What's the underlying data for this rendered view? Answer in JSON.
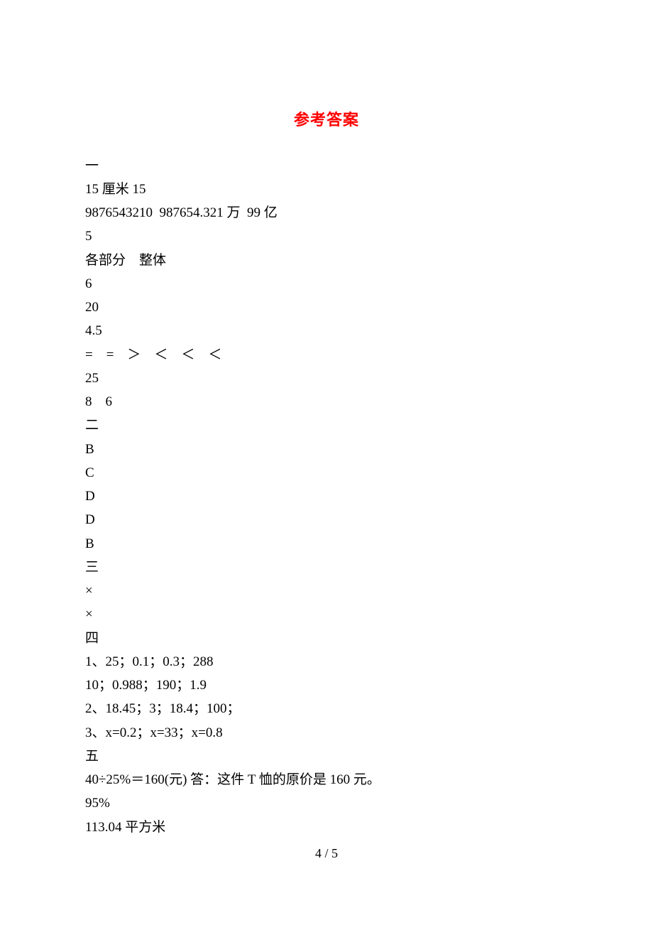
{
  "title": "参考答案",
  "sections": {
    "one": {
      "heading": "一",
      "lines": [
        "15 厘米 15",
        "9876543210  987654.321 万  99 亿",
        "5",
        "各部分    整体",
        "6",
        "20",
        "4.5",
        "=    =    ＞    ＜    ＜    ＜",
        "25",
        "8    6"
      ]
    },
    "two": {
      "heading": "二",
      "lines": [
        "B",
        "C",
        "D",
        "D",
        "B"
      ]
    },
    "three": {
      "heading": "三",
      "lines": [
        "×",
        "×"
      ]
    },
    "four": {
      "heading": "四",
      "lines": [
        "1、25；0.1；0.3；288",
        "10；0.988；190；1.9",
        "2、18.45；3；18.4；100；",
        "3、x=0.2；x=33；x=0.8"
      ]
    },
    "five": {
      "heading": "五",
      "lines": [
        "40÷25%＝160(元) 答：这件 T 恤的原价是 160 元。",
        "95%",
        "113.04 平方米"
      ]
    }
  },
  "footer": "4 / 5"
}
